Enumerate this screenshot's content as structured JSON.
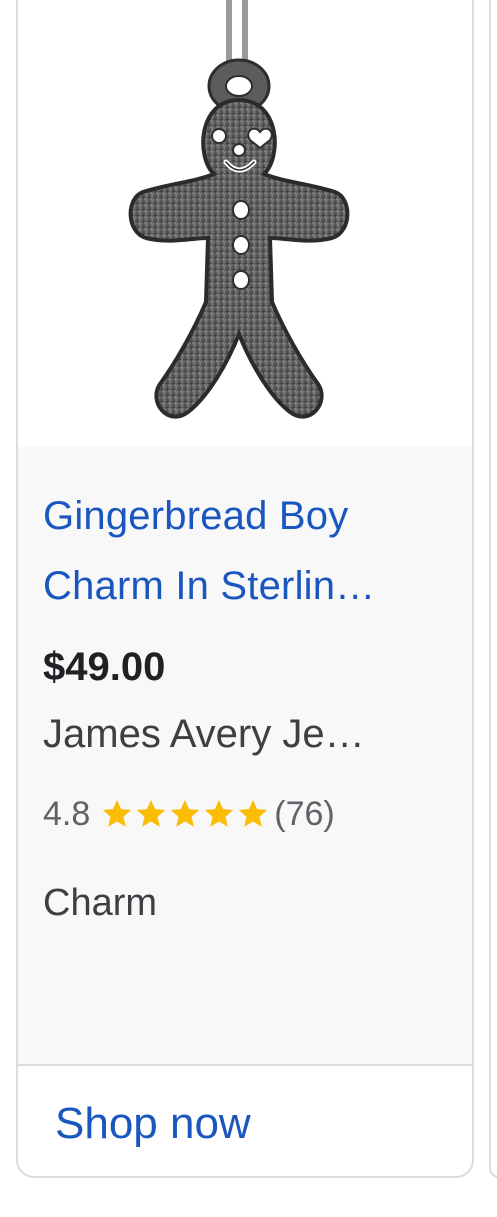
{
  "product": {
    "image_alt": "Gingerbread boy charm in sterling silver",
    "title": "Gingerbread Boy Charm In Sterlin…",
    "price": "$49.00",
    "merchant": "James Avery Je…",
    "rating": {
      "value": "4.8",
      "stars_filled": 5,
      "review_count": "(76)",
      "star_color": "#fbbc04"
    },
    "category": "Charm"
  },
  "cta": {
    "label": "Shop now"
  },
  "colors": {
    "link_blue": "#1a56c0",
    "info_bg": "#f8f8f9",
    "border": "#dadce0"
  },
  "icons": {
    "star": "star-icon",
    "product_image": "gingerbread-charm-image"
  }
}
